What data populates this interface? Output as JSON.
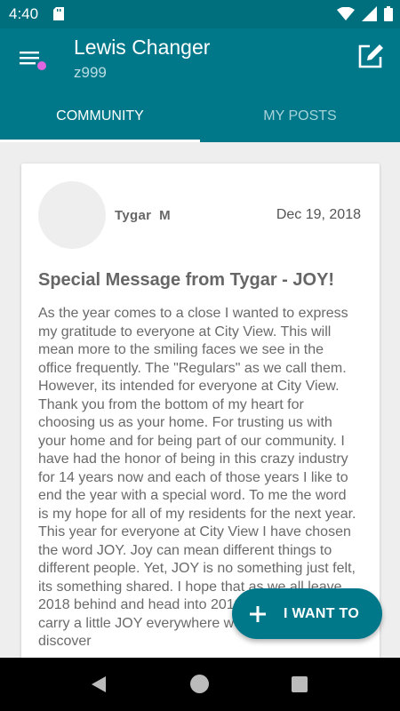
{
  "status_bar": {
    "time": "4:40",
    "icons": [
      "sd-card-icon",
      "wifi-icon",
      "signal-icon",
      "battery-icon"
    ]
  },
  "app_bar": {
    "title": "Lewis Changer",
    "subtitle": "z999",
    "menu_icon": "menu-icon",
    "notification_dot_color": "#e066e0",
    "edit_icon": "edit-icon"
  },
  "tabs": [
    {
      "label": "COMMUNITY",
      "active": true
    },
    {
      "label": "MY POSTS",
      "active": false
    }
  ],
  "post": {
    "author": "Tygar  M",
    "date": "Dec 19, 2018",
    "title": "Special Message from Tygar - JOY!",
    "body": "As the year comes to a close I wanted to express my gratitude to everyone at City View. This will mean more to the smiling faces we see in the office frequently. The \"Regulars\" as we call them. However, its intended for everyone at City View. Thank you from the bottom of my heart for choosing us as your home. For trusting us with your home and for being part of our community. I have had the honor of being in this crazy industry for 14 years now and each of those years I like to end the year with a special word. To me the word is my hope for all of my residents for the next year. This year for everyone at City View I have chosen the word JOY. Joy can mean different things to different people. Yet, JOY is no something just felt, its something shared. I hope that as we all leave 2018 behind and head into 2019 that we will all carry a little JOY everywhere we go. May you discover"
  },
  "fab": {
    "label": "I WANT TO",
    "icon": "plus-icon"
  },
  "colors": {
    "primary": "#00788a",
    "status_bar": "#006f7d",
    "accent_dot": "#e066e0"
  }
}
